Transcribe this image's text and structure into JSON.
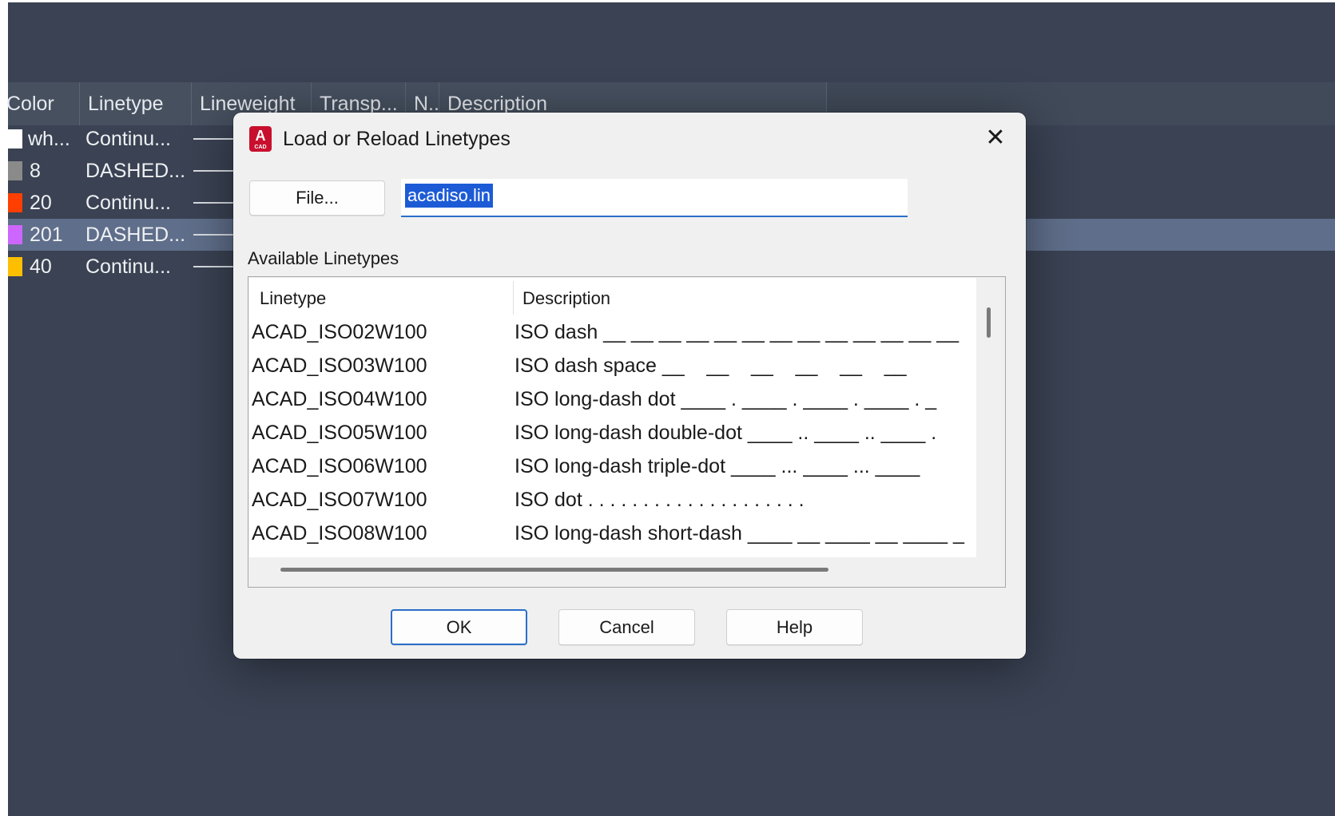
{
  "layer_manager": {
    "columns": [
      "Color",
      "Linetype",
      "Lineweight",
      "Transp...",
      "N..",
      "Description"
    ],
    "rows": [
      {
        "color_label": "wh...",
        "color": "#ffffff",
        "linetype": "Continu...",
        "selected": false
      },
      {
        "color_label": "8",
        "color": "#8a8a8a",
        "linetype": "DASHED...",
        "selected": false
      },
      {
        "color_label": "20",
        "color": "#ff3f00",
        "linetype": "Continu...",
        "selected": false
      },
      {
        "color_label": "201",
        "color": "#cc66ff",
        "linetype": "DASHED...",
        "selected": true
      },
      {
        "color_label": "40",
        "color": "#ffbf00",
        "linetype": "Continu...",
        "selected": false
      }
    ]
  },
  "dialog": {
    "title": "Load or Reload Linetypes",
    "app_icon": "autocad-icon",
    "app_icon_letter": "A",
    "app_icon_caption": "CAD",
    "file_button": "File...",
    "file_value": "acadiso.lin",
    "available_label": "Available Linetypes",
    "list_headers": {
      "linetype": "Linetype",
      "description": "Description"
    },
    "linetypes": [
      {
        "name": "ACAD_ISO02W100",
        "description": "ISO dash __ __ __ __ __ __ __ __ __ __ __ __ __"
      },
      {
        "name": "ACAD_ISO03W100",
        "description": "ISO dash space __    __    __    __    __    __"
      },
      {
        "name": "ACAD_ISO04W100",
        "description": "ISO long-dash dot ____ . ____ . ____ . ____ . _"
      },
      {
        "name": "ACAD_ISO05W100",
        "description": "ISO long-dash double-dot ____ .. ____ .. ____ ."
      },
      {
        "name": "ACAD_ISO06W100",
        "description": "ISO long-dash triple-dot ____ ... ____ ... ____"
      },
      {
        "name": "ACAD_ISO07W100",
        "description": "ISO dot . . . . . . . . . . . . . . . . . . . ."
      },
      {
        "name": "ACAD_ISO08W100",
        "description": "ISO long-dash short-dash ____ __ ____ __ ____ _"
      }
    ],
    "ok_button": "OK",
    "cancel_button": "Cancel",
    "help_button": "Help"
  }
}
